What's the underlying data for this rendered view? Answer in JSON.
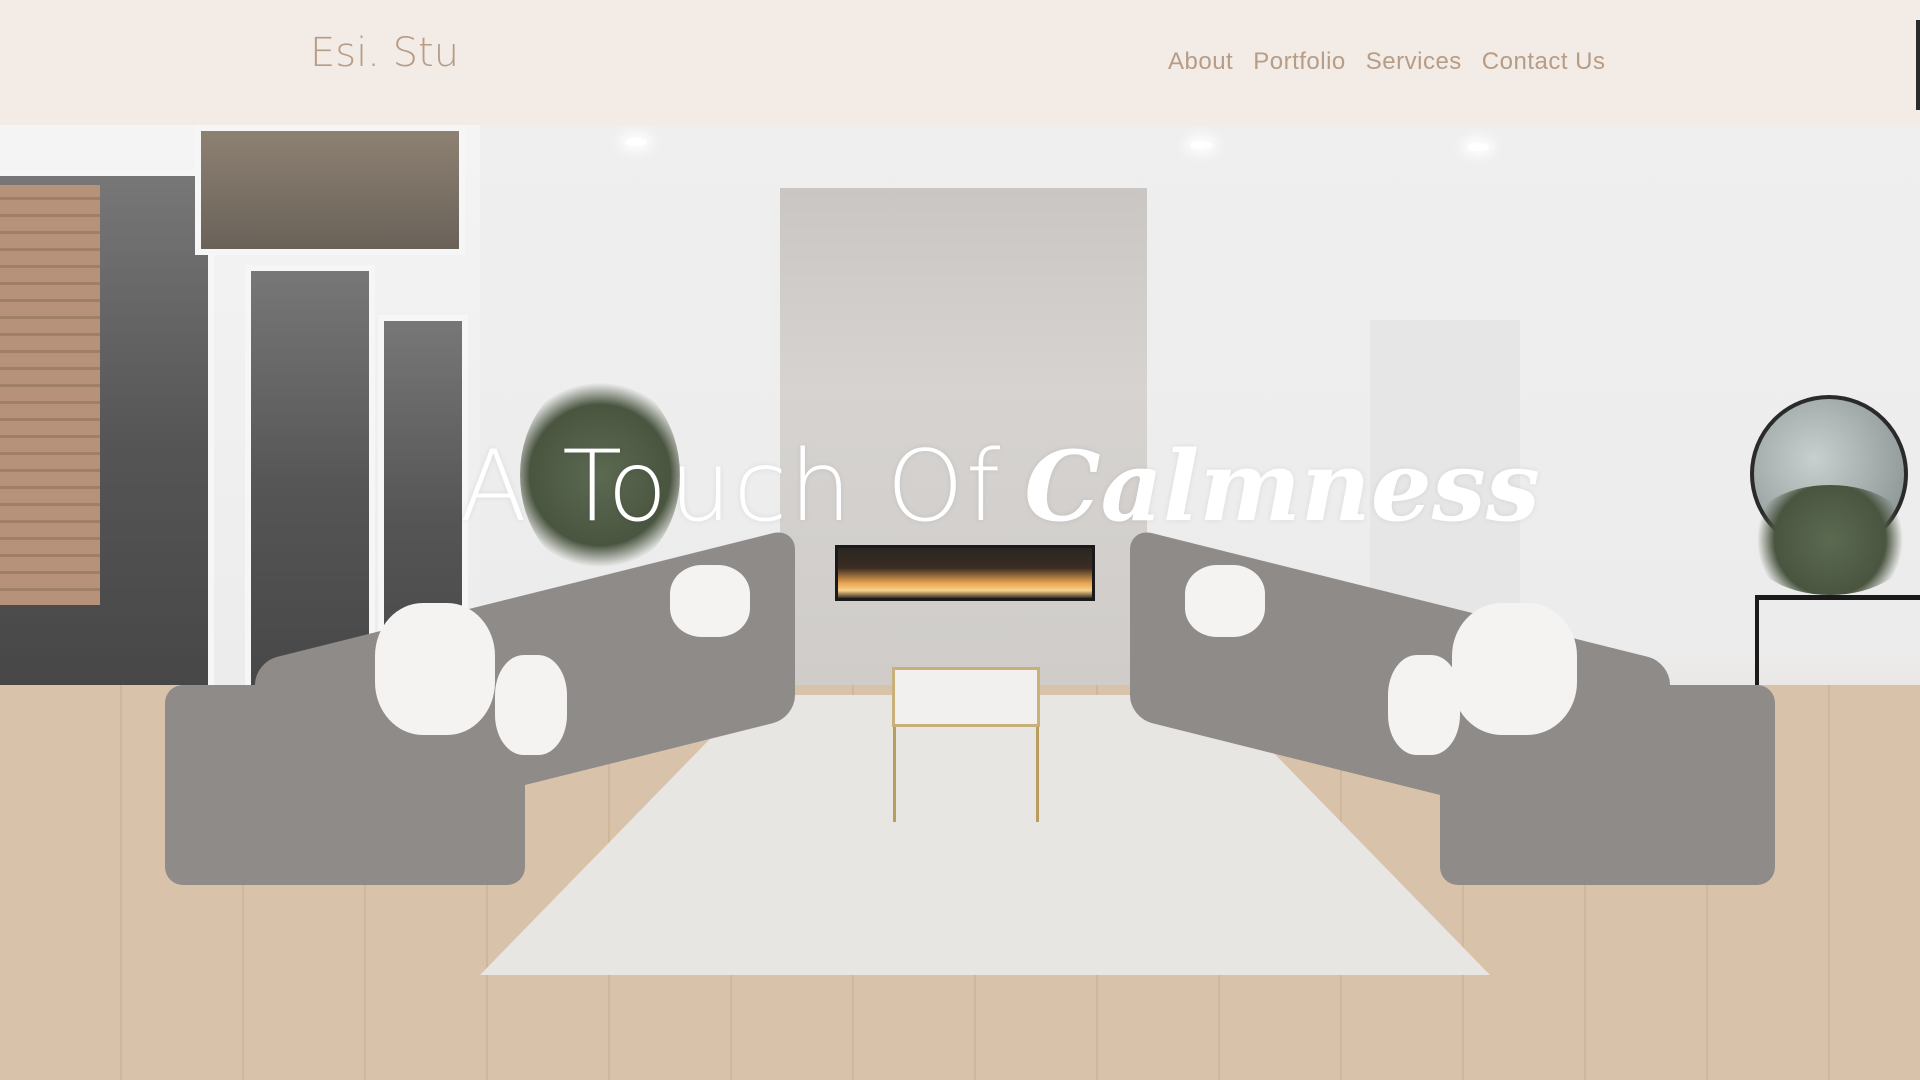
{
  "header": {
    "logo_text": "Esi. Stu",
    "nav": [
      {
        "label": "About"
      },
      {
        "label": "Portfolio"
      },
      {
        "label": "Services"
      },
      {
        "label": "Contact Us"
      }
    ]
  },
  "hero": {
    "title_plain": "A Touch Of",
    "title_script": "Calmness",
    "image_description": "living-room-photo"
  },
  "colors": {
    "header_bg": "#f2ebe6",
    "accent_text": "#b79c86",
    "hero_text": "#ffffff"
  }
}
